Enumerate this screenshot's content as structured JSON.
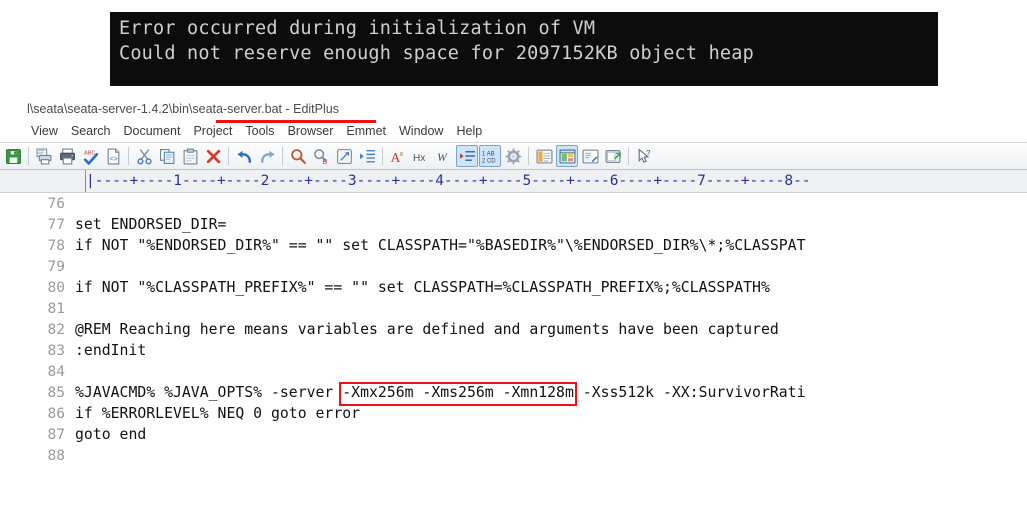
{
  "console": {
    "name": "jvm-error-console",
    "background": "#0c0c0c",
    "text_color": "#cfcfcf",
    "lines": [
      "Error occurred during initialization of VM",
      "Could not reserve enough space for 2097152KB object heap"
    ]
  },
  "editor_window": {
    "title": "l\\seata\\seata-server-1.4.2\\bin\\seata-server.bat - EditPlus",
    "menu": {
      "items": [
        {
          "label": "View"
        },
        {
          "label": "Search"
        },
        {
          "label": "Document"
        },
        {
          "label": "Project"
        },
        {
          "label": "Tools"
        },
        {
          "label": "Browser"
        },
        {
          "label": "Emmet"
        },
        {
          "label": "Window"
        },
        {
          "label": "Help"
        }
      ],
      "underline_color": "#ee1111"
    },
    "toolbar": {
      "buttons": [
        {
          "name": "save-icon",
          "tip": "Save"
        },
        {
          "sep": true
        },
        {
          "name": "print-preview-icon",
          "tip": "Print Preview"
        },
        {
          "name": "print-icon",
          "tip": "Print"
        },
        {
          "name": "spell-check-icon",
          "tip": "Spell Check"
        },
        {
          "name": "view-source-icon",
          "tip": "View in Browser"
        },
        {
          "sep": true
        },
        {
          "name": "cut-icon",
          "tip": "Cut"
        },
        {
          "name": "copy-icon",
          "tip": "Copy"
        },
        {
          "name": "paste-icon",
          "tip": "Paste"
        },
        {
          "name": "delete-icon",
          "tip": "Delete"
        },
        {
          "sep": true
        },
        {
          "name": "undo-icon",
          "tip": "Undo"
        },
        {
          "name": "redo-icon",
          "tip": "Redo"
        },
        {
          "sep": true
        },
        {
          "name": "find-icon",
          "tip": "Find"
        },
        {
          "name": "replace-icon",
          "tip": "Replace"
        },
        {
          "name": "goto-icon",
          "tip": "Go To"
        },
        {
          "name": "indent-icon",
          "tip": "Indent"
        },
        {
          "sep": true
        },
        {
          "name": "font-icon",
          "tip": "Font"
        },
        {
          "name": "hex-viewer-icon",
          "tip": "Hex Viewer"
        },
        {
          "name": "word-wrap-icon",
          "tip": "Word Wrap"
        },
        {
          "name": "show-whitespace-icon",
          "tip": "Show Spaces",
          "active": true
        },
        {
          "name": "line-numbers-icon",
          "tip": "Line Numbers",
          "active": true
        },
        {
          "name": "preferences-icon",
          "tip": "Preferences"
        },
        {
          "sep": true
        },
        {
          "name": "document-selector-icon",
          "tip": "Document Selector"
        },
        {
          "name": "directory-window-icon",
          "tip": "Directory Window",
          "active": true
        },
        {
          "name": "clip-library-icon",
          "tip": "Cliptext Window"
        },
        {
          "name": "output-window-icon",
          "tip": "Output Window"
        },
        {
          "sep": true
        },
        {
          "name": "help-pointer-icon",
          "tip": "Context Help"
        }
      ]
    },
    "ruler": {
      "scale": "|----+----1----+----2----+----3----+----4----+----5----+----6----+----7----+----8--",
      "color": "#27339b"
    },
    "code": {
      "lines": [
        {
          "no": "76",
          "text": ""
        },
        {
          "no": "77",
          "text": "set ENDORSED_DIR="
        },
        {
          "no": "78",
          "text": "if NOT \"%ENDORSED_DIR%\" == \"\" set CLASSPATH=\"%BASEDIR%\"\\%ENDORSED_DIR%\\*;%CLASSPAT"
        },
        {
          "no": "79",
          "text": ""
        },
        {
          "no": "80",
          "text": "if NOT \"%CLASSPATH_PREFIX%\" == \"\" set CLASSPATH=%CLASSPATH_PREFIX%;%CLASSPATH%"
        },
        {
          "no": "81",
          "text": ""
        },
        {
          "no": "82",
          "text": "@REM Reaching here means variables are defined and arguments have been captured"
        },
        {
          "no": "83",
          "text": ":endInit"
        },
        {
          "no": "84",
          "text": ""
        },
        {
          "no": "85",
          "text": "%JAVACMD% %JAVA_OPTS% -server -Xmx256m -Xms256m -Xmn128m -Xss512k -XX:SurvivorRati"
        },
        {
          "no": "86",
          "text": "if %ERRORLEVEL% NEQ 0 goto error"
        },
        {
          "no": "87",
          "text": "goto end"
        },
        {
          "no": "88",
          "text": ""
        }
      ],
      "annotation": {
        "name": "jvm-memory-options-highlight",
        "text": "-Xmx256m -Xms256m -Xmn128m",
        "color": "#ee1111"
      }
    }
  }
}
